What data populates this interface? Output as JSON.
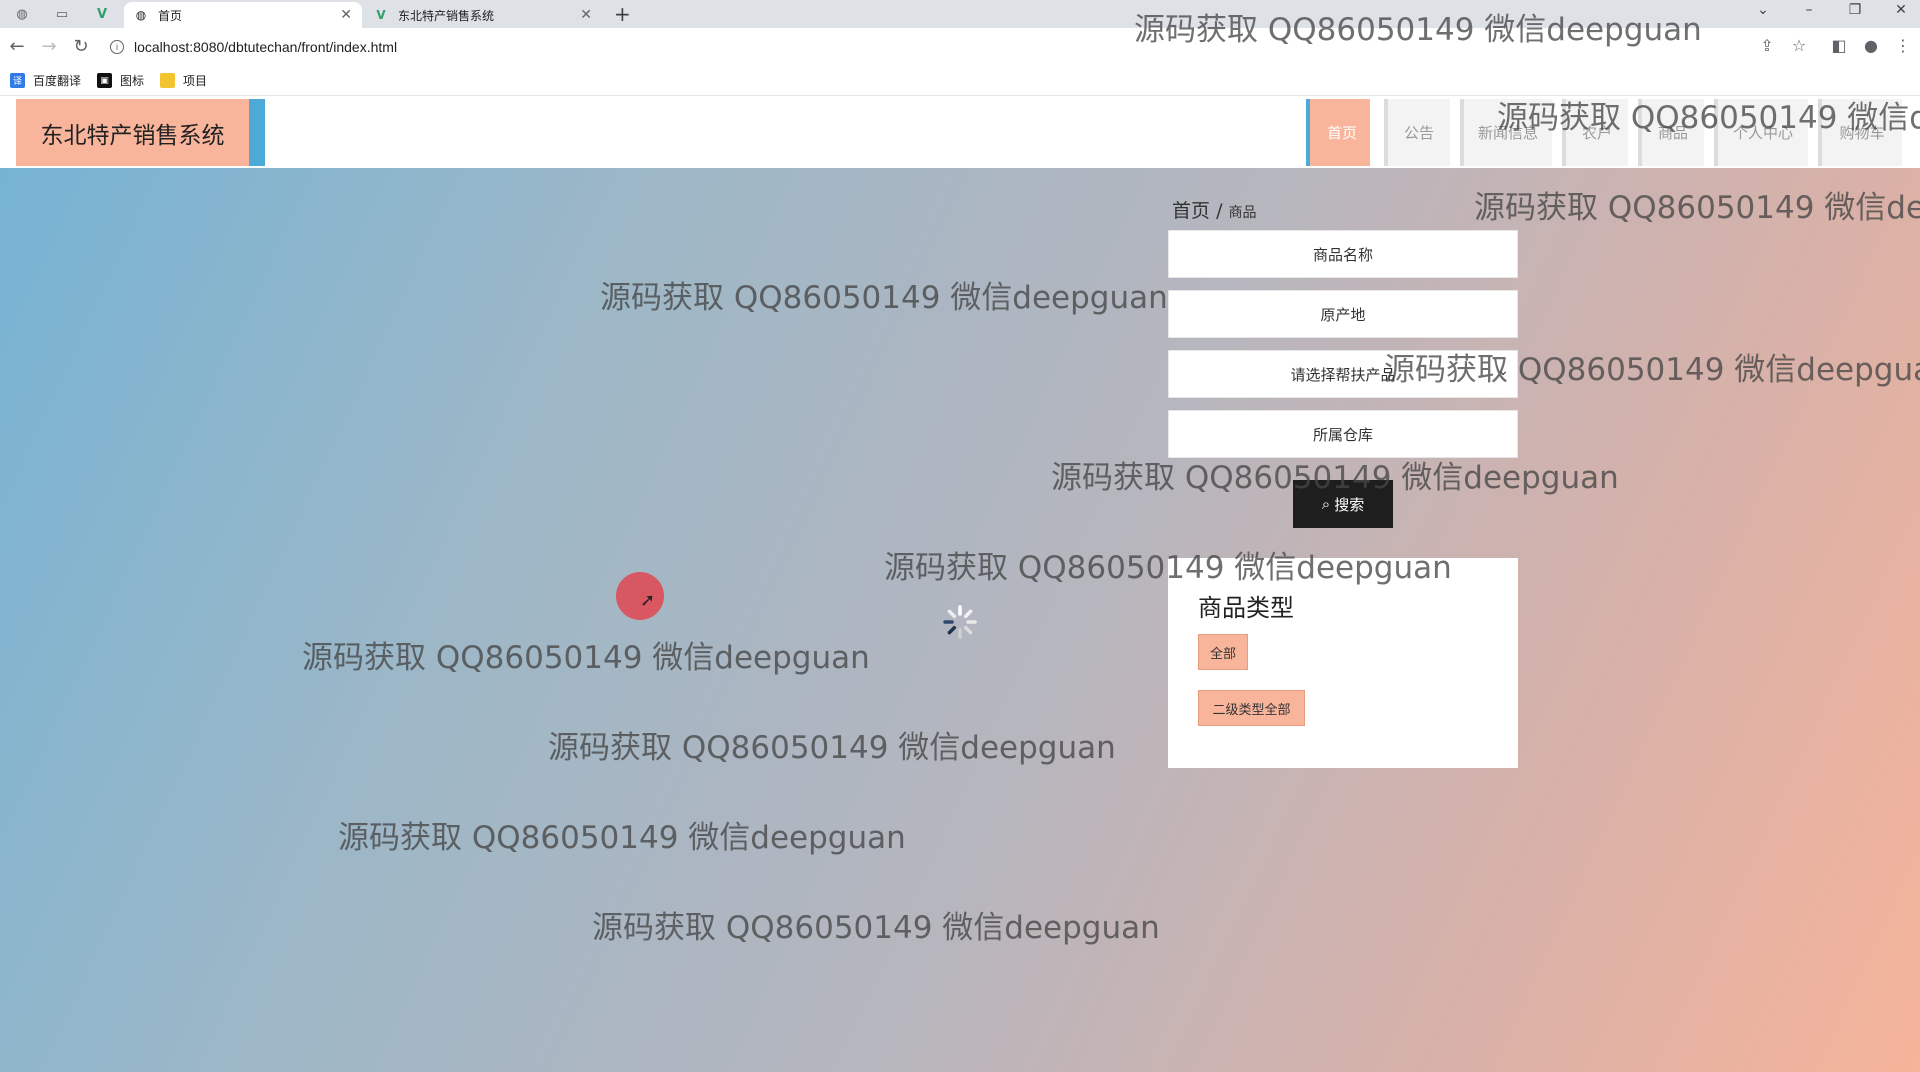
{
  "browser": {
    "tabs": [
      {
        "title": "首页",
        "active": true
      },
      {
        "title": "东北特产销售系统",
        "active": false
      }
    ],
    "url": "localhost:8080/dbtutechan/front/index.html",
    "bookmarks": [
      "百度翻译",
      "图标",
      "项目"
    ]
  },
  "site": {
    "logo": "东北特产销售系统",
    "nav": [
      "首页",
      "公告",
      "新闻信息",
      "农户",
      "商品",
      "个人中心",
      "购物车"
    ],
    "nav_active_index": 0
  },
  "breadcrumb": {
    "home": "首页",
    "separator": "/",
    "current": "商品"
  },
  "search_form": {
    "name_placeholder": "商品名称",
    "origin_placeholder": "原产地",
    "help_select": "请选择帮扶产品",
    "warehouse_placeholder": "所属仓库",
    "search_label": "搜索"
  },
  "category_panel": {
    "title": "商品类型",
    "tags": [
      "全部",
      "二级类型全部"
    ]
  },
  "watermark": "源码获取 QQ86050149 微信deepguan",
  "colors": {
    "accent": "#f8b59b",
    "blue_bar": "#4da9d6",
    "search_button": "#1e1e1e",
    "cursor_highlight": "#e14650"
  }
}
